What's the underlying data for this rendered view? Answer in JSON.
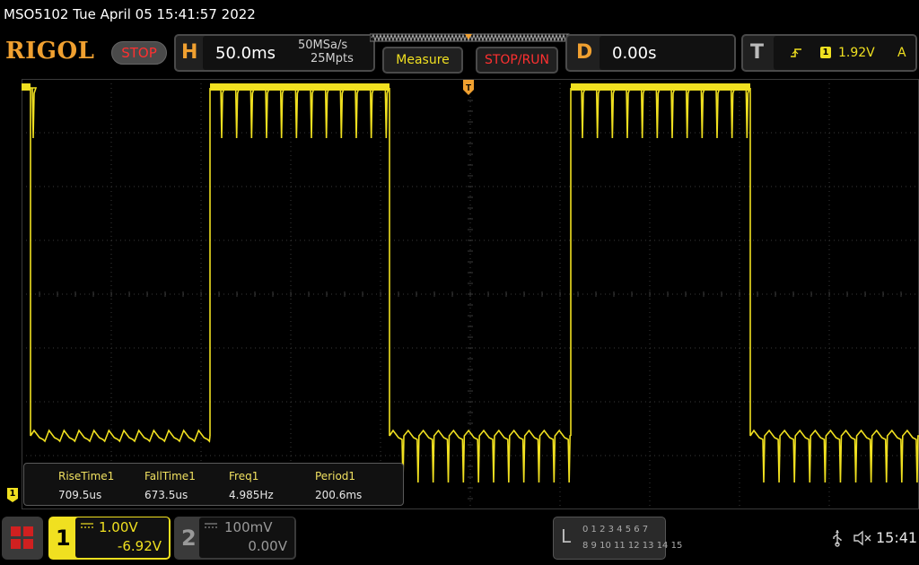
{
  "header": {
    "title": "MSO5102  Tue April 05 15:41:57 2022"
  },
  "toolbar": {
    "brand": "RIGOL",
    "run_state": "STOP",
    "horizontal": {
      "letter": "H",
      "timebase": "50.0ms",
      "sample_rate": "50MSa/s",
      "memory_depth": "25Mpts"
    },
    "measure_label": "Measure",
    "stop_run_label": "STOP/RUN",
    "delay": {
      "letter": "D",
      "value": "0.00s"
    },
    "trigger": {
      "letter": "T",
      "channel": "1",
      "level": "1.92V",
      "mode": "A"
    }
  },
  "measurements": {
    "items": [
      {
        "label": "RiseTime1",
        "value": "709.5us"
      },
      {
        "label": "FallTime1",
        "value": "673.5us"
      },
      {
        "label": "Freq1",
        "value": "4.985Hz"
      },
      {
        "label": "Period1",
        "value": "200.6ms"
      }
    ]
  },
  "channels": {
    "ch1": {
      "number": "1",
      "scale": "1.00V",
      "offset": "-6.92V",
      "color": "#f0e020"
    },
    "ch2": {
      "number": "2",
      "scale": "100mV",
      "offset": "0.00V",
      "color": "#8a8a8a"
    }
  },
  "logic_analyzer": {
    "letter": "L",
    "row1": "0 1 2 3  4 5 6 7",
    "row2": "8 9 10 11 12 13 14 15"
  },
  "status": {
    "time": "15:41"
  },
  "colors": {
    "trace": "#f0e020",
    "grid": "#3a3a3a",
    "accent": "#f0a030",
    "stop": "#ff3030"
  }
}
